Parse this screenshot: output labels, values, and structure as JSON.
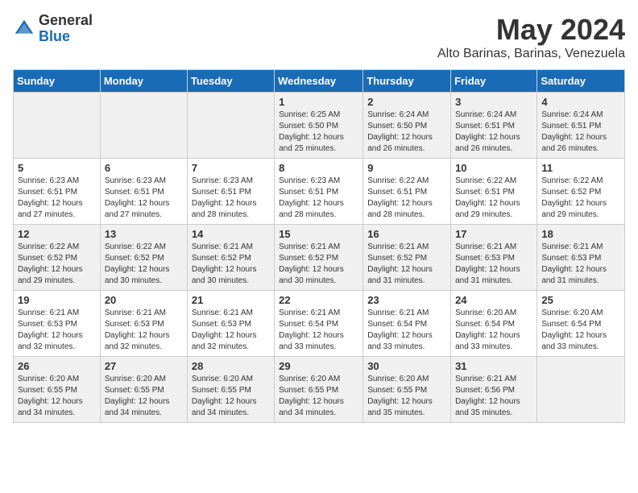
{
  "header": {
    "logo_general": "General",
    "logo_blue": "Blue",
    "month_title": "May 2024",
    "subtitle": "Alto Barinas, Barinas, Venezuela"
  },
  "days_of_week": [
    "Sunday",
    "Monday",
    "Tuesday",
    "Wednesday",
    "Thursday",
    "Friday",
    "Saturday"
  ],
  "weeks": [
    [
      {
        "day": "",
        "info": ""
      },
      {
        "day": "",
        "info": ""
      },
      {
        "day": "",
        "info": ""
      },
      {
        "day": "1",
        "info": "Sunrise: 6:25 AM\nSunset: 6:50 PM\nDaylight: 12 hours\nand 25 minutes."
      },
      {
        "day": "2",
        "info": "Sunrise: 6:24 AM\nSunset: 6:50 PM\nDaylight: 12 hours\nand 26 minutes."
      },
      {
        "day": "3",
        "info": "Sunrise: 6:24 AM\nSunset: 6:51 PM\nDaylight: 12 hours\nand 26 minutes."
      },
      {
        "day": "4",
        "info": "Sunrise: 6:24 AM\nSunset: 6:51 PM\nDaylight: 12 hours\nand 26 minutes."
      }
    ],
    [
      {
        "day": "5",
        "info": "Sunrise: 6:23 AM\nSunset: 6:51 PM\nDaylight: 12 hours\nand 27 minutes."
      },
      {
        "day": "6",
        "info": "Sunrise: 6:23 AM\nSunset: 6:51 PM\nDaylight: 12 hours\nand 27 minutes."
      },
      {
        "day": "7",
        "info": "Sunrise: 6:23 AM\nSunset: 6:51 PM\nDaylight: 12 hours\nand 28 minutes."
      },
      {
        "day": "8",
        "info": "Sunrise: 6:23 AM\nSunset: 6:51 PM\nDaylight: 12 hours\nand 28 minutes."
      },
      {
        "day": "9",
        "info": "Sunrise: 6:22 AM\nSunset: 6:51 PM\nDaylight: 12 hours\nand 28 minutes."
      },
      {
        "day": "10",
        "info": "Sunrise: 6:22 AM\nSunset: 6:51 PM\nDaylight: 12 hours\nand 29 minutes."
      },
      {
        "day": "11",
        "info": "Sunrise: 6:22 AM\nSunset: 6:52 PM\nDaylight: 12 hours\nand 29 minutes."
      }
    ],
    [
      {
        "day": "12",
        "info": "Sunrise: 6:22 AM\nSunset: 6:52 PM\nDaylight: 12 hours\nand 29 minutes."
      },
      {
        "day": "13",
        "info": "Sunrise: 6:22 AM\nSunset: 6:52 PM\nDaylight: 12 hours\nand 30 minutes."
      },
      {
        "day": "14",
        "info": "Sunrise: 6:21 AM\nSunset: 6:52 PM\nDaylight: 12 hours\nand 30 minutes."
      },
      {
        "day": "15",
        "info": "Sunrise: 6:21 AM\nSunset: 6:52 PM\nDaylight: 12 hours\nand 30 minutes."
      },
      {
        "day": "16",
        "info": "Sunrise: 6:21 AM\nSunset: 6:52 PM\nDaylight: 12 hours\nand 31 minutes."
      },
      {
        "day": "17",
        "info": "Sunrise: 6:21 AM\nSunset: 6:53 PM\nDaylight: 12 hours\nand 31 minutes."
      },
      {
        "day": "18",
        "info": "Sunrise: 6:21 AM\nSunset: 6:53 PM\nDaylight: 12 hours\nand 31 minutes."
      }
    ],
    [
      {
        "day": "19",
        "info": "Sunrise: 6:21 AM\nSunset: 6:53 PM\nDaylight: 12 hours\nand 32 minutes."
      },
      {
        "day": "20",
        "info": "Sunrise: 6:21 AM\nSunset: 6:53 PM\nDaylight: 12 hours\nand 32 minutes."
      },
      {
        "day": "21",
        "info": "Sunrise: 6:21 AM\nSunset: 6:53 PM\nDaylight: 12 hours\nand 32 minutes."
      },
      {
        "day": "22",
        "info": "Sunrise: 6:21 AM\nSunset: 6:54 PM\nDaylight: 12 hours\nand 33 minutes."
      },
      {
        "day": "23",
        "info": "Sunrise: 6:21 AM\nSunset: 6:54 PM\nDaylight: 12 hours\nand 33 minutes."
      },
      {
        "day": "24",
        "info": "Sunrise: 6:20 AM\nSunset: 6:54 PM\nDaylight: 12 hours\nand 33 minutes."
      },
      {
        "day": "25",
        "info": "Sunrise: 6:20 AM\nSunset: 6:54 PM\nDaylight: 12 hours\nand 33 minutes."
      }
    ],
    [
      {
        "day": "26",
        "info": "Sunrise: 6:20 AM\nSunset: 6:55 PM\nDaylight: 12 hours\nand 34 minutes."
      },
      {
        "day": "27",
        "info": "Sunrise: 6:20 AM\nSunset: 6:55 PM\nDaylight: 12 hours\nand 34 minutes."
      },
      {
        "day": "28",
        "info": "Sunrise: 6:20 AM\nSunset: 6:55 PM\nDaylight: 12 hours\nand 34 minutes."
      },
      {
        "day": "29",
        "info": "Sunrise: 6:20 AM\nSunset: 6:55 PM\nDaylight: 12 hours\nand 34 minutes."
      },
      {
        "day": "30",
        "info": "Sunrise: 6:20 AM\nSunset: 6:55 PM\nDaylight: 12 hours\nand 35 minutes."
      },
      {
        "day": "31",
        "info": "Sunrise: 6:21 AM\nSunset: 6:56 PM\nDaylight: 12 hours\nand 35 minutes."
      },
      {
        "day": "",
        "info": ""
      }
    ]
  ]
}
